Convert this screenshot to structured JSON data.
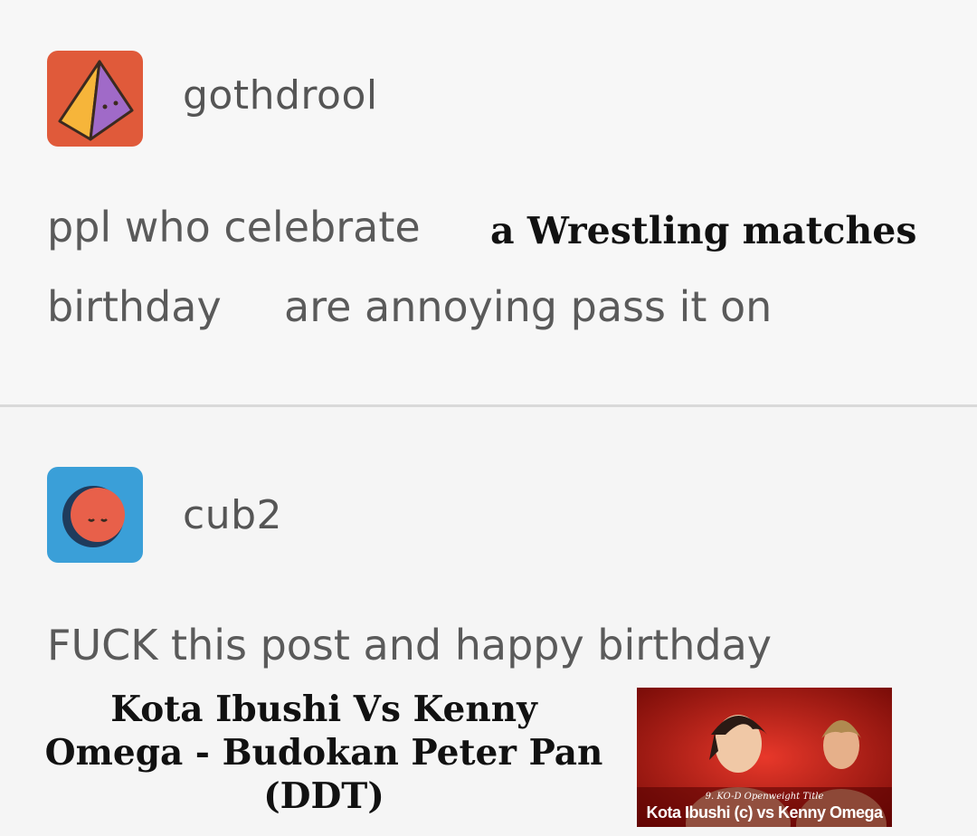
{
  "posts": [
    {
      "username": "gothdrool",
      "avatar_icon": "pyramid-icon",
      "line1": "ppl who celebrate",
      "line1_overlay": "a Wrestling matches",
      "line2_a": "birthday",
      "line2_b": "are annoying pass it on"
    },
    {
      "username": "cub2",
      "avatar_icon": "moon-face-icon",
      "text": "FUCK this post and happy birthday"
    }
  ],
  "caption": "Kota Ibushi Vs Kenny Omega - Budokan Peter Pan (DDT)",
  "poster": {
    "subtitle": "9. KO-D Openweight Title",
    "title": "Kota Ibushi (c) vs Kenny Omega"
  },
  "colors": {
    "avatar1_bg": "#e05a3a",
    "avatar2_bg": "#3a9fd8",
    "poster_bg": "#c21a12"
  }
}
